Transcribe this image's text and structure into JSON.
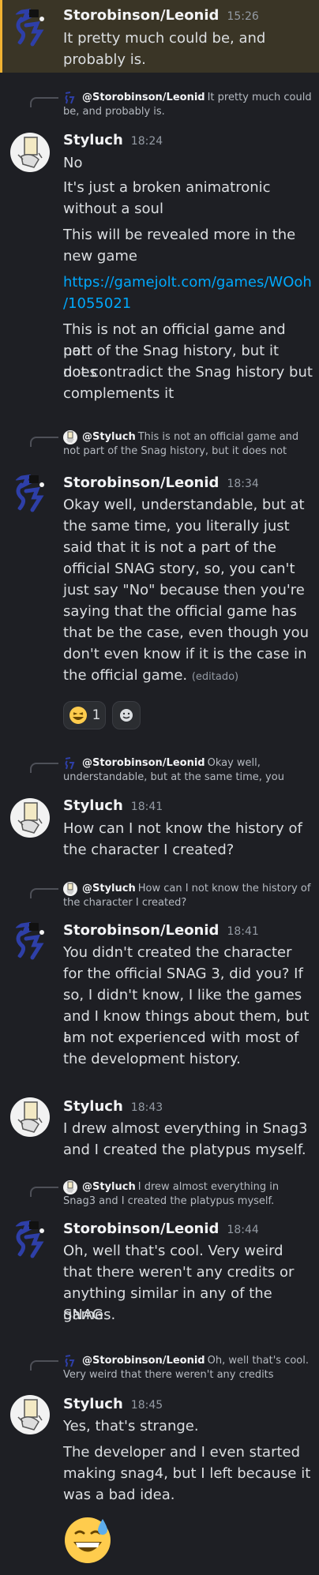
{
  "messages": [
    {
      "author": "Storobinson/Leonid",
      "time": "15:26",
      "lines": [
        "It pretty much could be, and",
        "probably is."
      ]
    },
    {
      "reply_author": "@Storobinson/Leonid",
      "reply_text": "It pretty much could be, and probably is.",
      "author": "Styluch",
      "time": "18:24",
      "lines": [
        "No",
        "It's just a broken animatronic",
        "without a soul",
        "This will be revealed more in the",
        "new game"
      ],
      "link_lines": [
        "https://gamejolt.com/games/WOoh",
        "/1055021"
      ],
      "lines2": [
        "This is not an official game and not",
        "part of the Snag history, but it does",
        "not contradict the Snag history but",
        "complements it"
      ]
    },
    {
      "reply_author": "@Styluch",
      "reply_text": "This is not an official game and not part of the Snag history, but it does not",
      "author": "Storobinson/Leonid",
      "time": "18:34",
      "lines": [
        "Okay well, understandable,  but at",
        "the same time, you literally just",
        "said that it is not a part of the",
        "official SNAG story, so, you can't",
        "just say \"No\" because then you're",
        "saying that the official game has",
        "that be the case, even though you",
        "don't even know if it is the case in",
        "the official game."
      ],
      "edited": "(editado)",
      "reaction_count": "1"
    },
    {
      "reply_author": "@Storobinson/Leonid",
      "reply_text": "Okay well, understandable,  but at the same time, you",
      "author": "Styluch",
      "time": "18:41",
      "lines": [
        "How can I not know the history of",
        "the character I created?"
      ]
    },
    {
      "reply_author": "@Styluch",
      "reply_text": "How can I not know the history of the character I created?",
      "author": "Storobinson/Leonid",
      "time": "18:41",
      "lines": [
        "You didn't created the character",
        "for the official SNAG 3, did you? If",
        "so, I didn't know, I like the games",
        "and I know things about them, but I",
        "am not experienced with most of",
        "the development history."
      ]
    },
    {
      "author": "Styluch",
      "time": "18:43",
      "lines": [
        "I drew almost everything in Snag3",
        "and I created the platypus myself."
      ]
    },
    {
      "reply_author": "@Styluch",
      "reply_text": "I drew almost everything in Snag3 and I created the platypus myself.",
      "author": "Storobinson/Leonid",
      "time": "18:44",
      "lines": [
        "Oh, well that's cool. Very weird",
        "that there weren't any credits or",
        "anything similar in any of the SNAG",
        "games."
      ]
    },
    {
      "reply_author": "@Storobinson/Leonid",
      "reply_text": "Oh, well that's cool. Very weird that there weren't any credits",
      "author": "Styluch",
      "time": "18:45",
      "lines": [
        "Yes, that's strange.",
        "The developer and I even started",
        "making snag4, but I left because it",
        "was a bad idea."
      ],
      "big_emoji": "grinning-sweat-emoji"
    }
  ],
  "colors": {
    "background": "#1e1f24",
    "highlight": "#3a3526",
    "highlight_bar": "#f0b232",
    "link": "#00a8fc",
    "storo_avatar": "#2e3fa8"
  }
}
